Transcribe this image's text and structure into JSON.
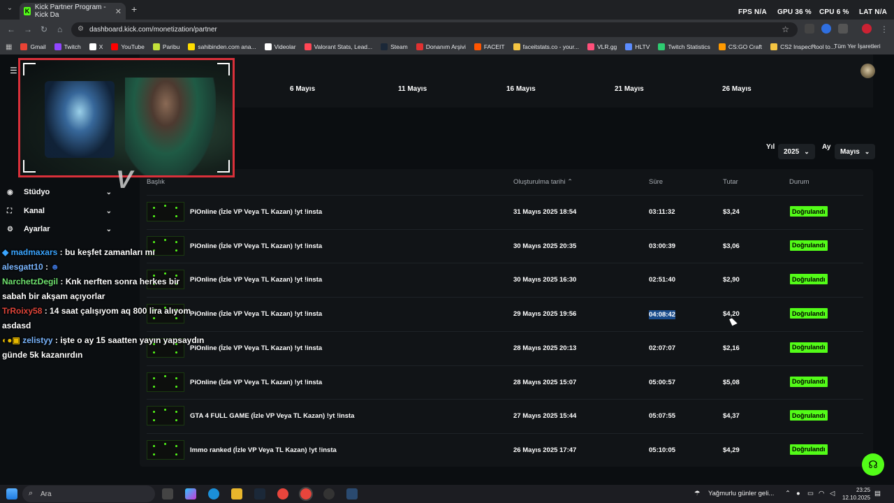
{
  "browser": {
    "tab_title": "Kick Partner Program - Kick Da",
    "url": "dashboard.kick.com/monetization/partner",
    "bookmarks": [
      "Gmail",
      "Twitch",
      "X",
      "YouTube",
      "Paribu",
      "sahibinden.com ana...",
      "Videolar",
      "Valorant Stats, Lead...",
      "Steam",
      "Donanım Arşivi",
      "FACEIT",
      "faceitstats.co - your...",
      "VLR.gg",
      "HLTV",
      "Twitch Statistics",
      "CS:GO Craft",
      "CS2 Inspect tool to..."
    ],
    "all_bookmarks": "Tüm Yer İşaretleri"
  },
  "overlay": {
    "fps_label": "FPS",
    "fps_value": "N/A",
    "gpu_label": "GPU",
    "gpu_value": "36 %",
    "cpu_label": "CPU",
    "cpu_value": "6 %",
    "lat_label": "LAT",
    "lat_value": "N/A"
  },
  "chart_axis": {
    "dates": [
      "6 Mayıs",
      "11 Mayıs",
      "16 Mayıs",
      "21 Mayıs",
      "26 Mayıs"
    ]
  },
  "sidebar": {
    "items": [
      {
        "label": "Stüdyo",
        "icon": "studio-icon"
      },
      {
        "label": "Kanal",
        "icon": "channel-icon"
      },
      {
        "label": "Ayarlar",
        "icon": "gear-icon"
      }
    ]
  },
  "filters": {
    "year_label": "Yıl",
    "year_value": "2025",
    "month_label": "Ay",
    "month_value": "Mayıs"
  },
  "table": {
    "headers": {
      "title": "Başlık",
      "created": "Oluşturulma tarihi",
      "duration": "Süre",
      "amount": "Tutar",
      "status": "Durum"
    },
    "rows": [
      {
        "title": "PiOnline (İzle VP Veya TL Kazan) !yt !insta",
        "date": "31 Mayıs 2025 18:54",
        "duration": "03:11:32",
        "amount": "$3,24",
        "status": "Doğrulandı"
      },
      {
        "title": "PiOnline (İzle VP Veya TL Kazan) !yt !insta",
        "date": "30 Mayıs 2025 20:35",
        "duration": "03:00:39",
        "amount": "$3,06",
        "status": "Doğrulandı"
      },
      {
        "title": "PiOnline (İzle VP Veya TL Kazan) !yt !insta",
        "date": "30 Mayıs 2025 16:30",
        "duration": "02:51:40",
        "amount": "$2,90",
        "status": "Doğrulandı"
      },
      {
        "title": "PiOnline (İzle VP Veya TL Kazan) !yt !insta",
        "date": "29 Mayıs 2025 19:56",
        "duration": "04:08:42",
        "amount": "$4,20",
        "status": "Doğrulandı"
      },
      {
        "title": "PiOnline (İzle VP Veya TL Kazan) !yt !insta",
        "date": "28 Mayıs 2025 20:13",
        "duration": "02:07:07",
        "amount": "$2,16",
        "status": "Doğrulandı"
      },
      {
        "title": "PiOnline (İzle VP Veya TL Kazan) !yt !insta",
        "date": "28 Mayıs 2025 15:07",
        "duration": "05:00:57",
        "amount": "$5,08",
        "status": "Doğrulandı"
      },
      {
        "title": "GTA 4 FULL GAME (İzle VP Veya TL Kazan) !yt !insta",
        "date": "27 Mayıs 2025 15:44",
        "duration": "05:07:55",
        "amount": "$4,37",
        "status": "Doğrulandı"
      },
      {
        "title": "Immo ranked (İzle VP Veya TL Kazan) !yt !insta",
        "date": "26 Mayıs 2025 17:47",
        "duration": "05:10:05",
        "amount": "$4,29",
        "status": "Doğrulandı"
      }
    ]
  },
  "chat": [
    {
      "user": "madmaxars",
      "msg": ": bu keşfet zamanları mı"
    },
    {
      "user": "alesgatt10",
      "msg": ":"
    },
    {
      "user": "NarchetzDegil",
      "msg": ": Knk nerften sonra herkes bir sabah bir akşam açıyorlar"
    },
    {
      "user": "TrRoixy58",
      "msg": ": 14 saat çalışıyom aq 800 lira alıyom asdasd"
    },
    {
      "user": "zelistyy",
      "msg": ": işte o ay 15 saatten yayın yapsaydın günde 5k kazanırdın"
    }
  ],
  "taskbar": {
    "search_placeholder": "Ara",
    "weather": "Yağmurlu günler geli...",
    "time": "23:25",
    "date": "12.10.2025"
  },
  "colors": {
    "kick_green": "#53fc18",
    "camera_border": "#d9303a"
  }
}
